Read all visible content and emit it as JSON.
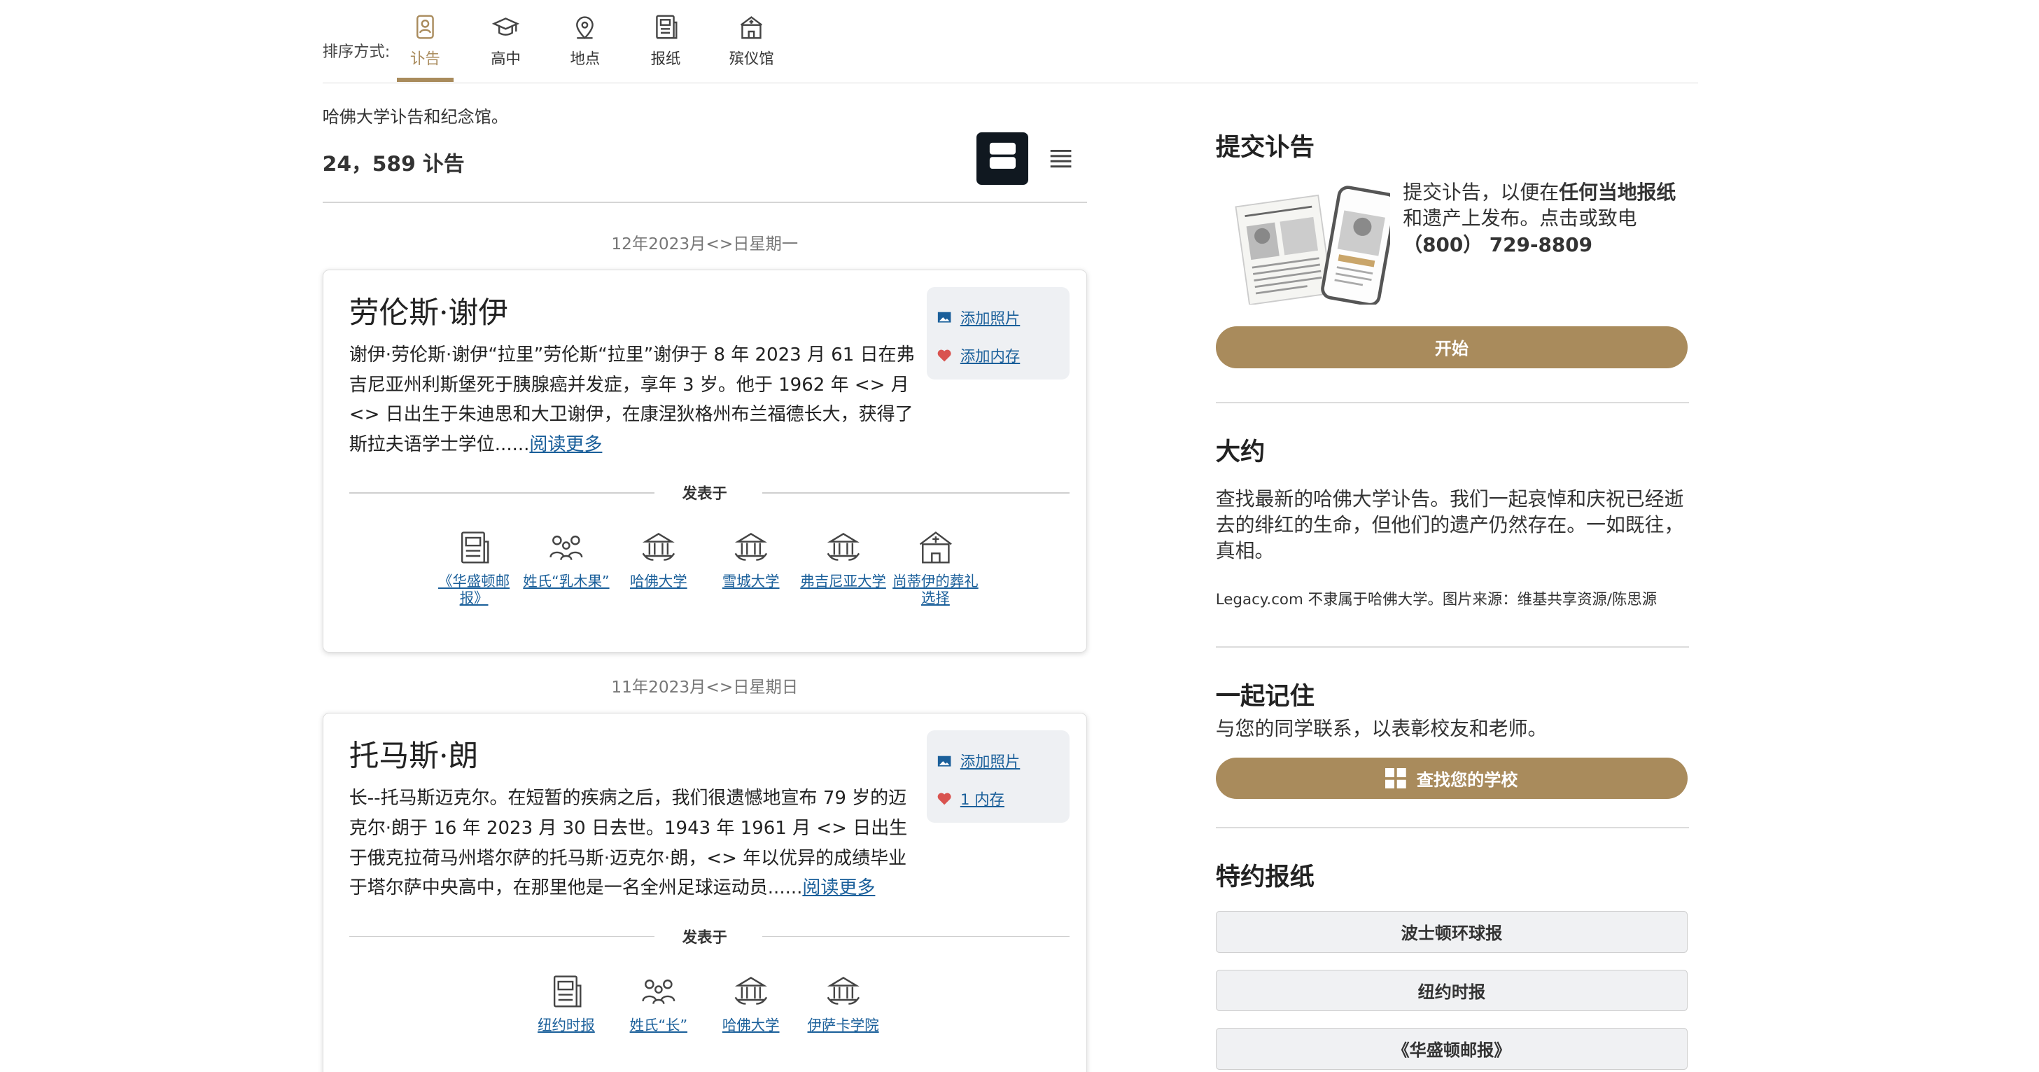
{
  "sort": {
    "label": "排序方式:",
    "tabs": [
      {
        "label": "讣告",
        "icon": "obituary-icon",
        "active": true
      },
      {
        "label": "高中",
        "icon": "graduation-cap-icon"
      },
      {
        "label": "地点",
        "icon": "location-pin-icon"
      },
      {
        "label": "报纸",
        "icon": "newspaper-icon"
      },
      {
        "label": "殡仪馆",
        "icon": "funeral-home-icon"
      }
    ]
  },
  "main": {
    "intro": "哈佛大学讣告和纪念馆。",
    "count": "24，589 讣告",
    "view_modes": [
      "grid-view-icon",
      "list-view-icon"
    ]
  },
  "obituaries": [
    {
      "date": "12年2023月<>日星期一",
      "name": "劳伦斯·谢伊",
      "excerpt": "谢伊·劳伦斯·谢伊“拉里”劳伦斯“拉里”谢伊于 8 年 2023 月 61 日在弗吉尼亚州利斯堡死于胰腺癌并发症，享年 3 岁。他于 1962 年 <> 月 <> 日出生于朱迪思和大卫谢伊，在康涅狄格州布兰福德长大，获得了斯拉夫语学士学位......",
      "read_more": "阅读更多",
      "actions": {
        "photo": "添加照片",
        "memory": "添加内存"
      },
      "published_label": "发表于",
      "published_in": [
        {
          "label": "《华盛顿邮报》",
          "icon": "newspaper-icon"
        },
        {
          "label": "姓氏“乳木果”",
          "icon": "family-icon"
        },
        {
          "label": "哈佛大学",
          "icon": "university-icon"
        },
        {
          "label": "雪城大学",
          "icon": "university-icon"
        },
        {
          "label": "弗吉尼亚大学",
          "icon": "university-icon"
        },
        {
          "label": "尚蒂伊的葬礼选择",
          "icon": "funeral-home-icon"
        }
      ]
    },
    {
      "date": "11年2023月<>日星期日",
      "name": "托马斯·朗",
      "excerpt": "长--托马斯迈克尔。在短暂的疾病之后，我们很遗憾地宣布 79 岁的迈克尔·朗于 16 年 2023 月 30 日去世。1943 年 1961 月 <> 日出生于俄克拉荷马州塔尔萨的托马斯·迈克尔·朗，<> 年以优异的成绩毕业于塔尔萨中央高中，在那里他是一名全州足球运动员......",
      "read_more": "阅读更多",
      "actions": {
        "photo": "添加照片",
        "memory": "1 内存"
      },
      "published_label": "发表于",
      "published_in": [
        {
          "label": "纽约时报",
          "icon": "newspaper-icon"
        },
        {
          "label": "姓氏“长”",
          "icon": "family-icon"
        },
        {
          "label": "哈佛大学",
          "icon": "university-icon"
        },
        {
          "label": "伊萨卡学院",
          "icon": "university-icon"
        }
      ]
    }
  ],
  "sidebar": {
    "submit": {
      "title": "提交讣告",
      "text_a": "提交讣告，以便在",
      "text_bold": "任何当地报纸",
      "text_b": "和遗产上发布。点击或致电",
      "phone": "（800） 729-8809",
      "button": "开始"
    },
    "about": {
      "title": "大约",
      "text": "查找最新的哈佛大学讣告。我们一起哀悼和庆祝已经逝去的绯红的生命，但他们的遗产仍然存在。一如既往，真相。",
      "note": "Legacy.com 不隶属于哈佛大学。图片来源：维基共享资源/陈思源"
    },
    "remember": {
      "title": "一起记住",
      "text": "与您的同学联系，以表彰校友和老师。",
      "button": "查找您的学校"
    },
    "papers": {
      "title": "特约报纸",
      "items": [
        "波士顿环球报",
        "纽约时报",
        "《华盛顿邮报》"
      ]
    }
  },
  "colors": {
    "accent": "#a98b5c",
    "link": "#1a5f9a",
    "dark": "#101820"
  }
}
